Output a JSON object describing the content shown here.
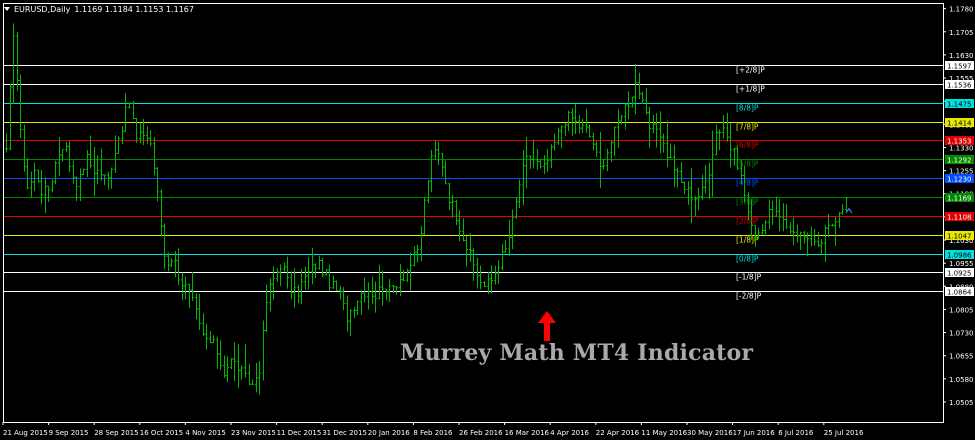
{
  "symbol_title": "EURUSD,Daily",
  "ohlc": "1.1169 1.1184 1.1153 1.1167",
  "watermark": "Murrey Math MT4 Indicator",
  "colors": {
    "background": "#000000",
    "axis": "#ffffff",
    "bars": "#00b800",
    "arrow": "#ff0000",
    "watermark": "#a9a9a9"
  },
  "icons": {
    "menu": "triangle-down-icon",
    "arrow": "red-up-arrow-icon",
    "marker": "chevron-up-icon"
  },
  "chart_data": {
    "type": "ohlc-bar",
    "symbol": "EURUSD",
    "timeframe": "Daily",
    "ylim": [
      1.044,
      1.1795
    ],
    "y_ticks": [
      "1.1780",
      "1.1705",
      "1.1630",
      "1.1555",
      "1.1480",
      "1.1405",
      "1.1330",
      "1.1255",
      "1.1180",
      "1.1105",
      "1.1030",
      "1.0955",
      "1.0880",
      "1.0805",
      "1.0730",
      "1.0655",
      "1.0580",
      "1.0505"
    ],
    "x_labels": [
      "21 Aug 2015",
      "9 Sep 2015",
      "28 Sep 2015",
      "16 Oct 2015",
      "4 Nov 2015",
      "23 Nov 2015",
      "11 Dec 2015",
      "31 Dec 2015",
      "20 Jan 2016",
      "8 Feb 2016",
      "26 Feb 2016",
      "16 Mar 2016",
      "4 Apr 2016",
      "22 Apr 2016",
      "11 May 2016",
      "30 May 2016",
      "17 Jun 2016",
      "6 Jul 2016",
      "25 Jul 2016"
    ],
    "last_price": 1.1167,
    "murrey_levels": [
      {
        "label": "[+2/8]P",
        "value": 1.1597,
        "value_text": "1.1597",
        "color": "#ffffff",
        "label_color": "#ffffff",
        "tag_text": "#000000"
      },
      {
        "label": "[+1/8]P",
        "value": 1.1536,
        "value_text": "1.1536",
        "color": "#ffffff",
        "label_color": "#ffffff",
        "tag_text": "#000000"
      },
      {
        "label": "[8/8]P",
        "value": 1.1475,
        "value_text": "1.1475",
        "color": "#00e0e0",
        "label_color": "#00e0e0",
        "tag_text": "#000000"
      },
      {
        "label": "[7/8]P",
        "value": 1.1414,
        "value_text": "1.1414",
        "color": "#e8e800",
        "label_color": "#e8e800",
        "tag_text": "#000000"
      },
      {
        "label": "[6/8]P",
        "value": 1.1353,
        "value_text": "1.1353",
        "color": "#e00000",
        "label_color": "#e00000",
        "tag_text": "#ffffff"
      },
      {
        "label": "[5/8]P",
        "value": 1.1292,
        "value_text": "1.1292",
        "color": "#008800",
        "label_color": "#008800",
        "tag_text": "#ffffff"
      },
      {
        "label": "[4/8]P",
        "value": 1.123,
        "value_text": "1.1230",
        "color": "#0050ff",
        "label_color": "#0050ff",
        "tag_text": "#ffffff"
      },
      {
        "label": "[3/8]P",
        "value": 1.1169,
        "value_text": "1.1169",
        "color": "#008800",
        "label_color": "#008800",
        "tag_text": "#ffffff"
      },
      {
        "label": "[2/8]P",
        "value": 1.1108,
        "value_text": "1.1108",
        "color": "#e00000",
        "label_color": "#e00000",
        "tag_text": "#ffffff"
      },
      {
        "label": "[1/8]P",
        "value": 1.1047,
        "value_text": "1.1047",
        "color": "#e8e800",
        "label_color": "#e8e800",
        "tag_text": "#000000"
      },
      {
        "label": "[0/8]P",
        "value": 1.0986,
        "value_text": "1.0986",
        "color": "#00e0e0",
        "label_color": "#00e0e0",
        "tag_text": "#000000"
      },
      {
        "label": "[-1/8]P",
        "value": 1.0925,
        "value_text": "1.0925",
        "color": "#ffffff",
        "label_color": "#ffffff",
        "tag_text": "#000000"
      },
      {
        "label": "[-2/8]P",
        "value": 1.0864,
        "value_text": "1.0864",
        "color": "#ffffff",
        "label_color": "#ffffff",
        "tag_text": "#000000"
      }
    ],
    "price_path": [
      1.131,
      1.172,
      1.135,
      1.119,
      1.126,
      1.118,
      1.12,
      1.13,
      1.135,
      1.125,
      1.121,
      1.13,
      1.126,
      1.125,
      1.122,
      1.132,
      1.14,
      1.148,
      1.135,
      1.138,
      1.134,
      1.115,
      1.095,
      1.098,
      1.09,
      1.087,
      1.081,
      1.072,
      1.07,
      1.068,
      1.06,
      1.064,
      1.062,
      1.058,
      1.056,
      1.062,
      1.085,
      1.091,
      1.096,
      1.088,
      1.085,
      1.09,
      1.093,
      1.096,
      1.092,
      1.088,
      1.086,
      1.078,
      1.082,
      1.086,
      1.087,
      1.085,
      1.089,
      1.086,
      1.09,
      1.092,
      1.096,
      1.1,
      1.12,
      1.132,
      1.13,
      1.118,
      1.112,
      1.105,
      1.098,
      1.092,
      1.088,
      1.09,
      1.096,
      1.1,
      1.11,
      1.123,
      1.13,
      1.129,
      1.125,
      1.13,
      1.136,
      1.142,
      1.143,
      1.14,
      1.139,
      1.135,
      1.126,
      1.132,
      1.138,
      1.145,
      1.148,
      1.155,
      1.145,
      1.138,
      1.14,
      1.132,
      1.128,
      1.122,
      1.119,
      1.117,
      1.118,
      1.125,
      1.138,
      1.14,
      1.133,
      1.128,
      1.117,
      1.105,
      1.106,
      1.11,
      1.113,
      1.108,
      1.107,
      1.106,
      1.104,
      1.105,
      1.099,
      1.105,
      1.108,
      1.113,
      1.116
    ]
  }
}
